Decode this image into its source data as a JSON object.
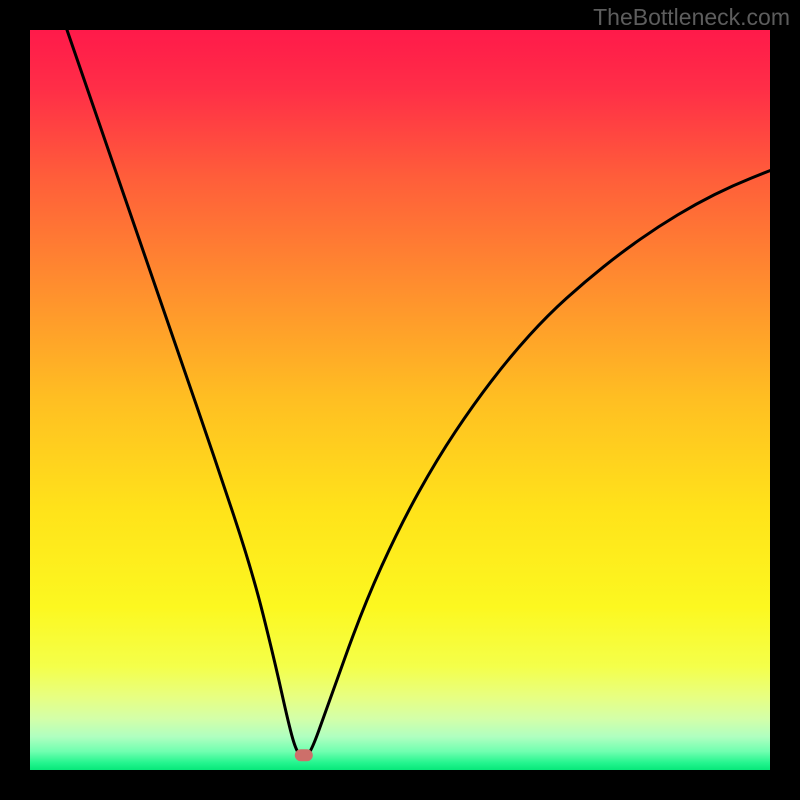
{
  "watermark": "TheBottleneck.com",
  "chart_data": {
    "type": "line",
    "title": "",
    "xlabel": "",
    "ylabel": "",
    "xlim": [
      0,
      100
    ],
    "ylim": [
      0,
      100
    ],
    "background": "gradient-red-yellow-green",
    "marker": {
      "x_pct": 37.0,
      "y_pct": 2.0,
      "color": "#cd6f6a"
    },
    "curve_points": [
      {
        "x_pct": 5.0,
        "y_pct": 100.0
      },
      {
        "x_pct": 10.0,
        "y_pct": 85.5
      },
      {
        "x_pct": 15.0,
        "y_pct": 71.0
      },
      {
        "x_pct": 20.0,
        "y_pct": 56.5
      },
      {
        "x_pct": 25.0,
        "y_pct": 42.0
      },
      {
        "x_pct": 30.0,
        "y_pct": 27.0
      },
      {
        "x_pct": 33.0,
        "y_pct": 15.0
      },
      {
        "x_pct": 35.0,
        "y_pct": 6.0
      },
      {
        "x_pct": 36.0,
        "y_pct": 2.5
      },
      {
        "x_pct": 37.0,
        "y_pct": 1.5
      },
      {
        "x_pct": 38.0,
        "y_pct": 2.5
      },
      {
        "x_pct": 40.0,
        "y_pct": 8.0
      },
      {
        "x_pct": 45.0,
        "y_pct": 22.0
      },
      {
        "x_pct": 50.0,
        "y_pct": 33.0
      },
      {
        "x_pct": 55.0,
        "y_pct": 42.0
      },
      {
        "x_pct": 60.0,
        "y_pct": 49.5
      },
      {
        "x_pct": 65.0,
        "y_pct": 56.0
      },
      {
        "x_pct": 70.0,
        "y_pct": 61.5
      },
      {
        "x_pct": 75.0,
        "y_pct": 66.0
      },
      {
        "x_pct": 80.0,
        "y_pct": 70.0
      },
      {
        "x_pct": 85.0,
        "y_pct": 73.5
      },
      {
        "x_pct": 90.0,
        "y_pct": 76.5
      },
      {
        "x_pct": 95.0,
        "y_pct": 79.0
      },
      {
        "x_pct": 100.0,
        "y_pct": 81.0
      }
    ]
  }
}
